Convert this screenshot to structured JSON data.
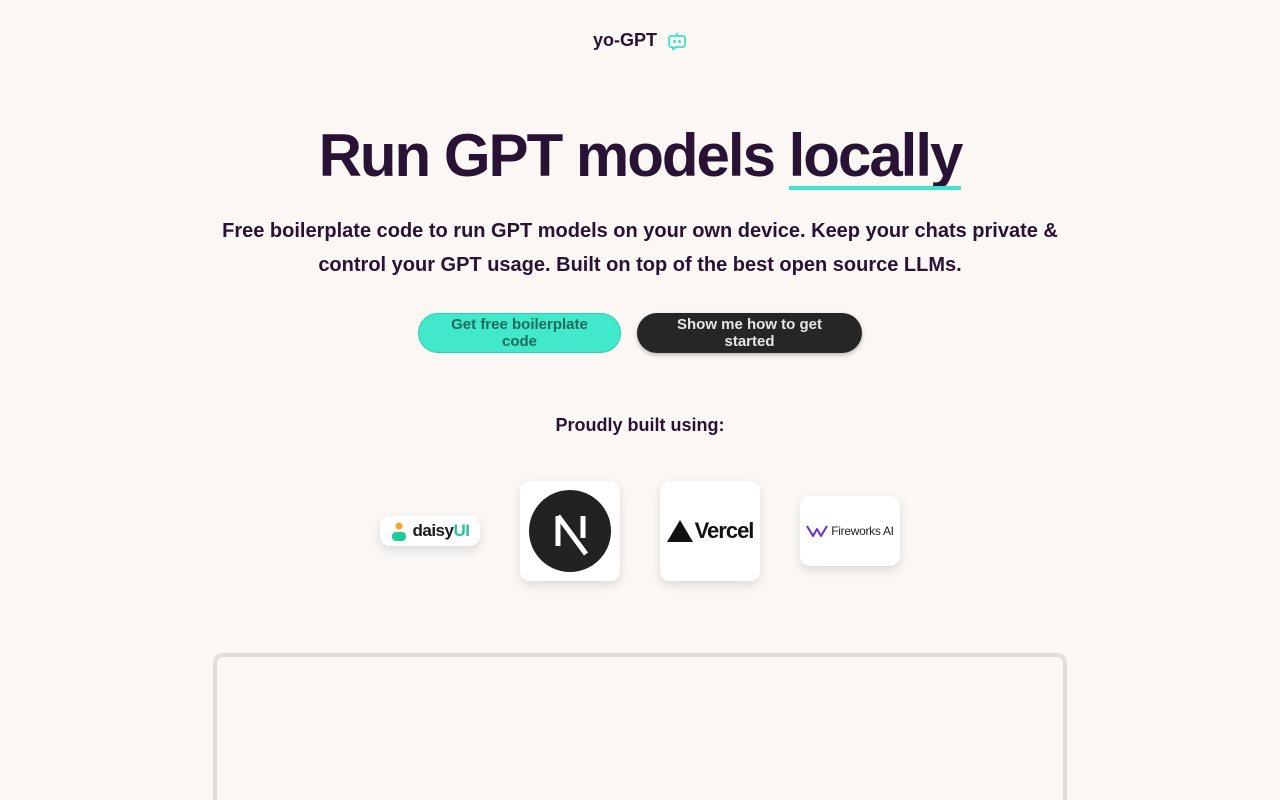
{
  "brand": {
    "name": "yo-GPT",
    "icon": "chat-bot-icon",
    "icon_color": "#3ee5c8"
  },
  "hero": {
    "title_main": "Run GPT models ",
    "title_highlight": "locally",
    "subtitle": "Free boilerplate code to run GPT models on your own device. Keep your chats private & control your GPT usage. Built on top of the best open source LLMs."
  },
  "cta": {
    "primary_label": "Get free boilerplate code",
    "secondary_label": "Show me how to get started"
  },
  "built_with": {
    "label": "Proudly built using:",
    "logos": [
      {
        "name": "daisy",
        "name_suffix": "UI"
      },
      {
        "name": "Next.js"
      },
      {
        "name": "Vercel"
      },
      {
        "name": "Fireworks AI"
      }
    ]
  },
  "colors": {
    "background": "#faf7f5",
    "text": "#291334",
    "accent": "#41e8c9",
    "dark_button": "#262626"
  }
}
